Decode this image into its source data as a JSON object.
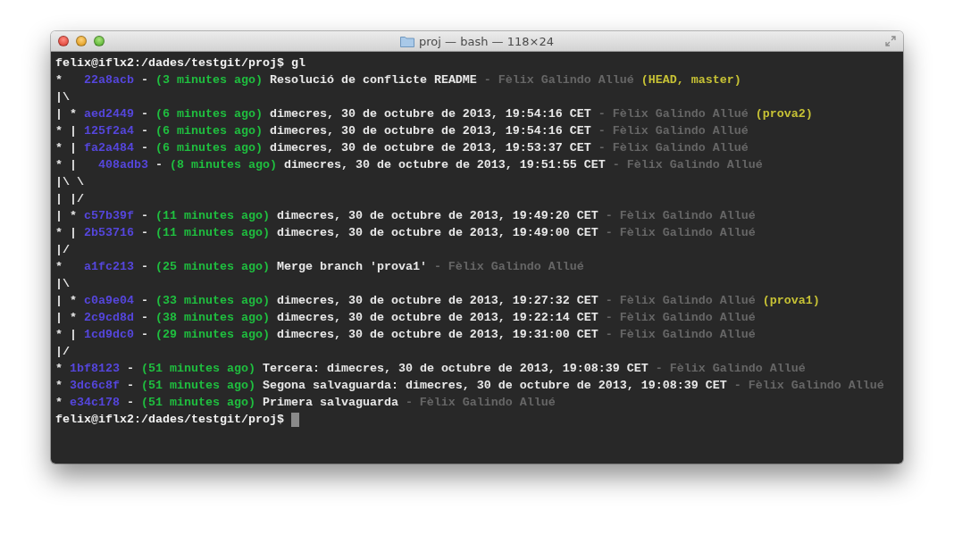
{
  "window": {
    "title": "proj — bash — 118×24"
  },
  "lines": [
    {
      "segments": [
        {
          "kind": "prompt",
          "text": "felix@iflx2:/dades/testgit/proj$"
        },
        {
          "kind": "command",
          "text": "gl"
        }
      ]
    },
    {
      "segments": [
        {
          "kind": "graph",
          "text": "*  "
        },
        {
          "kind": "hash",
          "text": "22a8acb"
        },
        {
          "kind": "sep",
          "text": "-"
        },
        {
          "kind": "age",
          "text": "(3 minutes ago)"
        },
        {
          "kind": "subject",
          "text": "Resolució de conflicte README"
        },
        {
          "kind": "author_sep",
          "text": "-"
        },
        {
          "kind": "author",
          "text": "Fèlix Galindo Allué"
        },
        {
          "kind": "refs",
          "text": "(HEAD, master)"
        }
      ]
    },
    {
      "segments": [
        {
          "kind": "graph",
          "text": "|\\"
        }
      ]
    },
    {
      "segments": [
        {
          "kind": "graph",
          "text": "| *"
        },
        {
          "kind": "hash",
          "text": "aed2449"
        },
        {
          "kind": "sep",
          "text": "-"
        },
        {
          "kind": "age",
          "text": "(6 minutes ago)"
        },
        {
          "kind": "subject",
          "text": "dimecres, 30 de octubre de 2013, 19:54:16 CET"
        },
        {
          "kind": "author_sep",
          "text": "-"
        },
        {
          "kind": "author",
          "text": "Fèlix Galindo Allué"
        },
        {
          "kind": "refs",
          "text": "(prova2)"
        }
      ]
    },
    {
      "segments": [
        {
          "kind": "graph",
          "text": "* |"
        },
        {
          "kind": "hash",
          "text": "125f2a4"
        },
        {
          "kind": "sep",
          "text": "-"
        },
        {
          "kind": "age",
          "text": "(6 minutes ago)"
        },
        {
          "kind": "subject",
          "text": "dimecres, 30 de octubre de 2013, 19:54:16 CET"
        },
        {
          "kind": "author_sep",
          "text": "-"
        },
        {
          "kind": "author",
          "text": "Fèlix Galindo Allué"
        }
      ]
    },
    {
      "segments": [
        {
          "kind": "graph",
          "text": "* |"
        },
        {
          "kind": "hash",
          "text": "fa2a484"
        },
        {
          "kind": "sep",
          "text": "-"
        },
        {
          "kind": "age",
          "text": "(6 minutes ago)"
        },
        {
          "kind": "subject",
          "text": "dimecres, 30 de octubre de 2013, 19:53:37 CET"
        },
        {
          "kind": "author_sep",
          "text": "-"
        },
        {
          "kind": "author",
          "text": "Fèlix Galindo Allué"
        }
      ]
    },
    {
      "segments": [
        {
          "kind": "graph",
          "text": "* |  "
        },
        {
          "kind": "hash",
          "text": "408adb3"
        },
        {
          "kind": "sep",
          "text": "-"
        },
        {
          "kind": "age",
          "text": "(8 minutes ago)"
        },
        {
          "kind": "subject",
          "text": "dimecres, 30 de octubre de 2013, 19:51:55 CET"
        },
        {
          "kind": "author_sep",
          "text": "-"
        },
        {
          "kind": "author",
          "text": "Fèlix Galindo Allué"
        }
      ]
    },
    {
      "segments": [
        {
          "kind": "graph",
          "text": "|\\ \\"
        }
      ]
    },
    {
      "segments": [
        {
          "kind": "graph",
          "text": "| |/"
        }
      ]
    },
    {
      "segments": [
        {
          "kind": "graph",
          "text": "| *"
        },
        {
          "kind": "hash",
          "text": "c57b39f"
        },
        {
          "kind": "sep",
          "text": "-"
        },
        {
          "kind": "age",
          "text": "(11 minutes ago)"
        },
        {
          "kind": "subject",
          "text": "dimecres, 30 de octubre de 2013, 19:49:20 CET"
        },
        {
          "kind": "author_sep",
          "text": "-"
        },
        {
          "kind": "author",
          "text": "Fèlix Galindo Allué"
        }
      ]
    },
    {
      "segments": [
        {
          "kind": "graph",
          "text": "* |"
        },
        {
          "kind": "hash",
          "text": "2b53716"
        },
        {
          "kind": "sep",
          "text": "-"
        },
        {
          "kind": "age",
          "text": "(11 minutes ago)"
        },
        {
          "kind": "subject",
          "text": "dimecres, 30 de octubre de 2013, 19:49:00 CET"
        },
        {
          "kind": "author_sep",
          "text": "-"
        },
        {
          "kind": "author",
          "text": "Fèlix Galindo Allué"
        }
      ]
    },
    {
      "segments": [
        {
          "kind": "graph",
          "text": "|/"
        }
      ]
    },
    {
      "segments": [
        {
          "kind": "graph",
          "text": "*  "
        },
        {
          "kind": "hash",
          "text": "a1fc213"
        },
        {
          "kind": "sep",
          "text": "-"
        },
        {
          "kind": "age",
          "text": "(25 minutes ago)"
        },
        {
          "kind": "subject",
          "text": "Merge branch 'prova1'"
        },
        {
          "kind": "author_sep",
          "text": "-"
        },
        {
          "kind": "author",
          "text": "Fèlix Galindo Allué"
        }
      ]
    },
    {
      "segments": [
        {
          "kind": "graph",
          "text": "|\\"
        }
      ]
    },
    {
      "segments": [
        {
          "kind": "graph",
          "text": "| *"
        },
        {
          "kind": "hash",
          "text": "c0a9e04"
        },
        {
          "kind": "sep",
          "text": "-"
        },
        {
          "kind": "age",
          "text": "(33 minutes ago)"
        },
        {
          "kind": "subject",
          "text": "dimecres, 30 de octubre de 2013, 19:27:32 CET"
        },
        {
          "kind": "author_sep",
          "text": "-"
        },
        {
          "kind": "author",
          "text": "Fèlix Galindo Allué"
        },
        {
          "kind": "refs",
          "text": "(prova1)"
        }
      ]
    },
    {
      "segments": [
        {
          "kind": "graph",
          "text": "| *"
        },
        {
          "kind": "hash",
          "text": "2c9cd8d"
        },
        {
          "kind": "sep",
          "text": "-"
        },
        {
          "kind": "age",
          "text": "(38 minutes ago)"
        },
        {
          "kind": "subject",
          "text": "dimecres, 30 de octubre de 2013, 19:22:14 CET"
        },
        {
          "kind": "author_sep",
          "text": "-"
        },
        {
          "kind": "author",
          "text": "Fèlix Galindo Allué"
        }
      ]
    },
    {
      "segments": [
        {
          "kind": "graph",
          "text": "* |"
        },
        {
          "kind": "hash",
          "text": "1cd9dc0"
        },
        {
          "kind": "sep",
          "text": "-"
        },
        {
          "kind": "age",
          "text": "(29 minutes ago)"
        },
        {
          "kind": "subject",
          "text": "dimecres, 30 de octubre de 2013, 19:31:00 CET"
        },
        {
          "kind": "author_sep",
          "text": "-"
        },
        {
          "kind": "author",
          "text": "Fèlix Galindo Allué"
        }
      ]
    },
    {
      "segments": [
        {
          "kind": "graph",
          "text": "|/"
        }
      ]
    },
    {
      "segments": [
        {
          "kind": "graph",
          "text": "*"
        },
        {
          "kind": "hash",
          "text": "1bf8123"
        },
        {
          "kind": "sep",
          "text": "-"
        },
        {
          "kind": "age",
          "text": "(51 minutes ago)"
        },
        {
          "kind": "subject",
          "text": "Tercera: dimecres, 30 de octubre de 2013, 19:08:39 CET"
        },
        {
          "kind": "author_sep",
          "text": "-"
        },
        {
          "kind": "author",
          "text": "Fèlix Galindo Allué"
        }
      ]
    },
    {
      "segments": [
        {
          "kind": "graph",
          "text": "*"
        },
        {
          "kind": "hash",
          "text": "3dc6c8f"
        },
        {
          "kind": "sep",
          "text": "-"
        },
        {
          "kind": "age",
          "text": "(51 minutes ago)"
        },
        {
          "kind": "subject",
          "text": "Segona salvaguarda: dimecres, 30 de octubre de 2013, 19:08:39 CET"
        },
        {
          "kind": "author_sep",
          "text": "-"
        },
        {
          "kind": "author",
          "text": "Fèlix Galindo Allué"
        }
      ]
    },
    {
      "segments": [
        {
          "kind": "graph",
          "text": "*"
        },
        {
          "kind": "hash",
          "text": "e34c178"
        },
        {
          "kind": "sep",
          "text": "-"
        },
        {
          "kind": "age",
          "text": "(51 minutes ago)"
        },
        {
          "kind": "subject",
          "text": "Primera salvaguarda"
        },
        {
          "kind": "author_sep",
          "text": "-"
        },
        {
          "kind": "author",
          "text": "Fèlix Galindo Allué"
        }
      ]
    },
    {
      "cursor": true,
      "segments": [
        {
          "kind": "prompt",
          "text": "felix@iflx2:/dades/testgit/proj$"
        }
      ]
    }
  ]
}
